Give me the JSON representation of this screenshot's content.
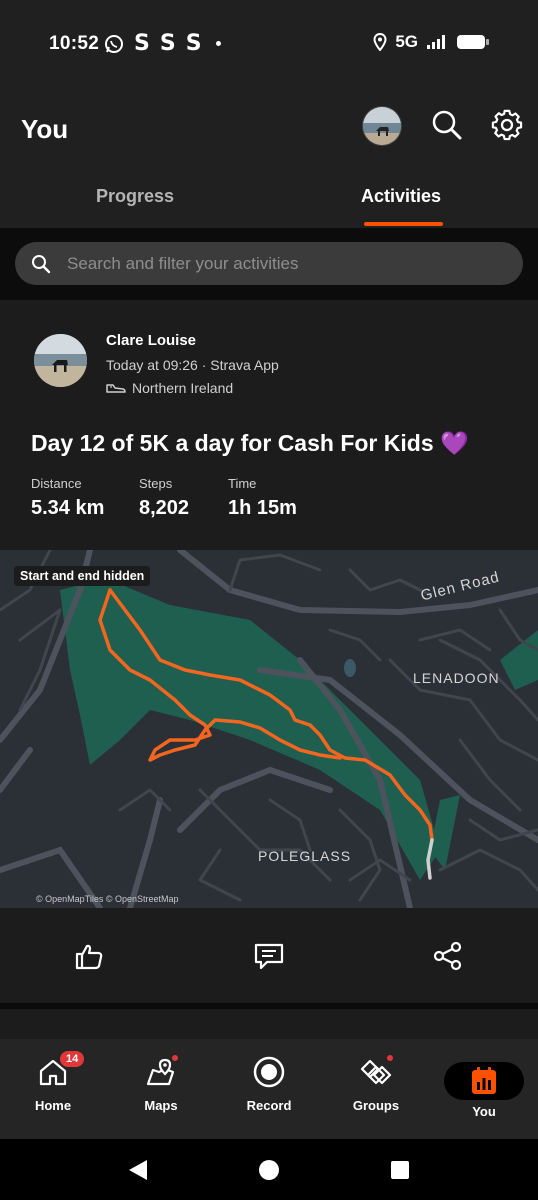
{
  "status_bar": {
    "time": "10:52",
    "notif_letters": [
      "S",
      "S",
      "S"
    ],
    "network": "5G"
  },
  "header": {
    "title": "You",
    "tabs": [
      {
        "label": "Progress",
        "active": false
      },
      {
        "label": "Activities",
        "active": true
      }
    ]
  },
  "search": {
    "placeholder": "Search and filter your activities"
  },
  "activity": {
    "athlete_name": "Clare Louise",
    "meta": "Today at 09:26 · Strava App",
    "location": "Northern Ireland",
    "title": "Day 12 of 5K a day for Cash For Kids",
    "title_emoji": "💜",
    "stats": [
      {
        "label": "Distance",
        "value": "5.34 km"
      },
      {
        "label": "Steps",
        "value": "8,202"
      },
      {
        "label": "Time",
        "value": "1h 15m"
      }
    ],
    "map": {
      "badge": "Start and end hidden",
      "attribution": "© OpenMapTiles © OpenStreetMap",
      "labels": [
        "Glen Road",
        "LENADOON",
        "POLEGLASS"
      ]
    }
  },
  "bottom_nav": [
    {
      "label": "Home",
      "icon": "home-icon",
      "badge": "14"
    },
    {
      "label": "Maps",
      "icon": "map-icon",
      "dot": true
    },
    {
      "label": "Record",
      "icon": "record-icon"
    },
    {
      "label": "Groups",
      "icon": "groups-icon",
      "dot": true
    },
    {
      "label": "You",
      "icon": "you-icon",
      "active": true
    }
  ],
  "colors": {
    "accent": "#fc5200",
    "background": "#101010",
    "card": "#1c1c1c",
    "route": "#f4661f",
    "park": "#1f5f4f",
    "badge": "#e0373b"
  }
}
